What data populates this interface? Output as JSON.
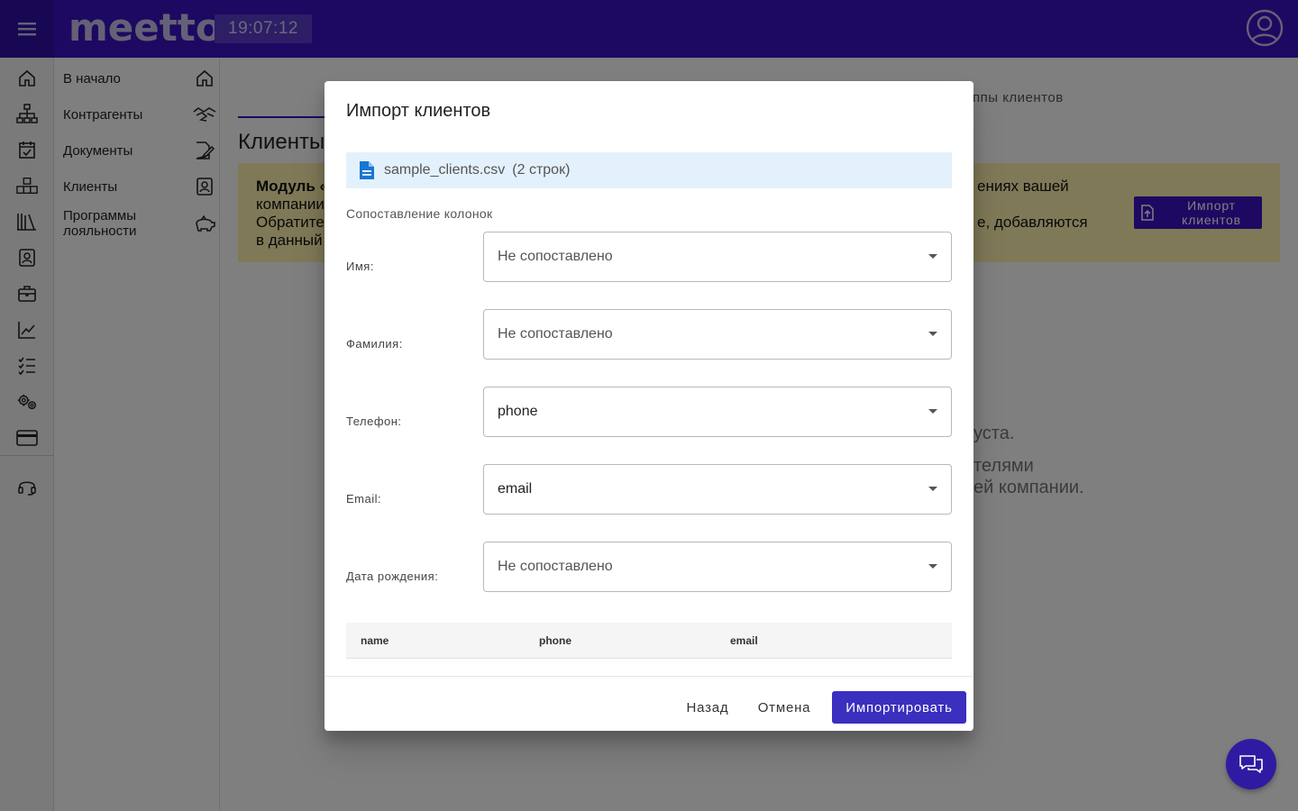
{
  "topbar": {
    "logo": "meetto",
    "clock": "19:07:12"
  },
  "sidebar": {
    "items": [
      {
        "label": "В начало",
        "icon": "home-icon"
      },
      {
        "label": "Контрагенты",
        "icon": "handshake-icon"
      },
      {
        "label": "Документы",
        "icon": "document-edit-icon"
      },
      {
        "label": "Клиенты",
        "icon": "contact-card-icon"
      },
      {
        "label": "Программы лояльности",
        "icon": "piggy-bank-icon"
      }
    ]
  },
  "rail": {
    "icons": [
      "home-icon",
      "org-tree-icon",
      "calendar-check-icon",
      "warehouse-boxes-icon",
      "library-icon",
      "contact-card-icon",
      "briefcase-icon",
      "chart-line-icon",
      "checklist-icon",
      "settings-gears-icon",
      "credit-card-icon",
      "headset-support-icon"
    ]
  },
  "main": {
    "tab_right": "ппы клиентов",
    "page_title": "Клиенты",
    "notice": {
      "line1": "Модуль «",
      "line2": "компании",
      "line3": "Обратите",
      "line4": "в данный",
      "right1": "ениях вашей",
      "right2": "е, добавляются"
    },
    "import_button": {
      "line1": "Импорт",
      "line2": "клиентов"
    },
    "empty": {
      "line1": "уста.",
      "line2": "телями",
      "line3": "ей компании."
    }
  },
  "dialog": {
    "title": "Импорт клиентов",
    "file": {
      "name": "sample_clients.csv",
      "rows": "(2 строк)"
    },
    "mapping_label": "Сопоставление колонок",
    "fields": [
      {
        "label": "Имя:",
        "value": "Не сопоставлено",
        "mapped": false
      },
      {
        "label": "Фамилия:",
        "value": "Не сопоставлено",
        "mapped": false
      },
      {
        "label": "Телефон:",
        "value": "phone",
        "mapped": true
      },
      {
        "label": "Email:",
        "value": "email",
        "mapped": true
      },
      {
        "label": "Дата рождения:",
        "value": "Не сопоставлено",
        "mapped": false
      }
    ],
    "preview_columns": [
      "name",
      "phone",
      "email"
    ],
    "buttons": {
      "back": "Назад",
      "cancel": "Отмена",
      "import": "Импортировать"
    }
  },
  "colors": {
    "brand": "#3a12c2",
    "primary_button": "#3a2fbf",
    "notice_bg": "#fff3b0",
    "file_bar_bg": "#e3f1fc"
  }
}
